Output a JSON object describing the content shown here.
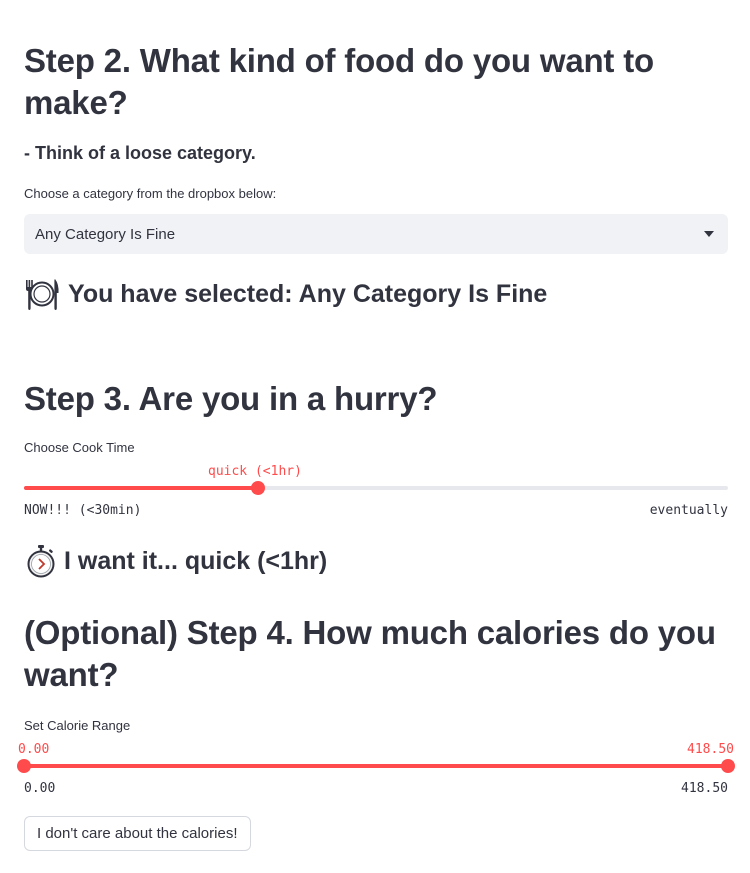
{
  "step2": {
    "heading": "Step 2. What kind of food do you want to make?",
    "subheading": "- Think of a loose category.",
    "select_label": "Choose a category from the dropbox below:",
    "selected_value": "Any Category Is Fine",
    "selection_line": "You have selected: Any Category Is Fine",
    "selection_icon": "plate-cutlery-icon"
  },
  "step3": {
    "heading": "Step 3. Are you in a hurry?",
    "slider_label": "Choose Cook Time",
    "current_value": "quick (<1hr)",
    "min_label": "NOW!!! (<30min)",
    "max_label": "eventually",
    "position_fraction": 0.333,
    "result_line": "I want it... quick (<1hr)",
    "result_icon": "stopwatch-icon"
  },
  "step4": {
    "heading": "(Optional) Step 4. How much calories do you want?",
    "slider_label": "Set Calorie Range",
    "low_value": "0.00",
    "high_value": "418.50",
    "min_label": "0.00",
    "max_label": "418.50",
    "range": [
      0.0,
      418.5
    ],
    "button_label": "I don't care about the calories!"
  },
  "colors": {
    "accent": "#ff4b4b",
    "text": "#31333f",
    "input_bg": "#f0f2f6",
    "track": "#e6e8ee"
  }
}
